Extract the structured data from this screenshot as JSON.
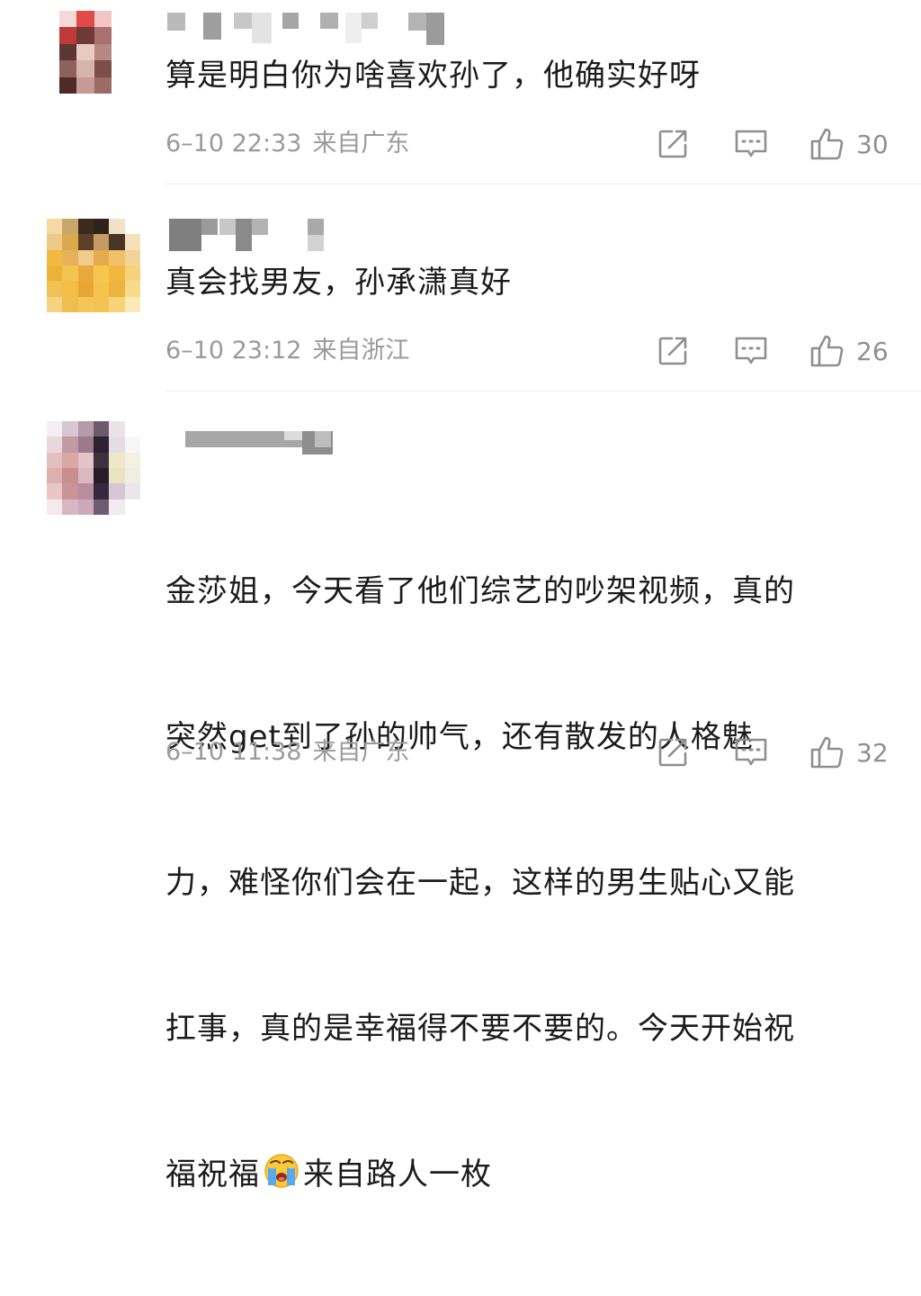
{
  "comments": [
    {
      "text": "算是明白你为啥喜欢孙了，他确实好呀",
      "time": "6–10 22:33",
      "location": "来自广东",
      "likes": "30"
    },
    {
      "text": "真会找男友，孙承潇真好",
      "time": "6–10 23:12",
      "location": "来自浙江",
      "likes": "26"
    },
    {
      "text_lines": [
        "金莎姐，今天看了他们综艺的吵架视频，真的",
        "突然get到了孙的帅气，还有散发的人格魅",
        "力，难怪你们会在一起，这样的男生贴心又能",
        "扛事，真的是幸福得不要不要的。今天开始祝"
      ],
      "text_last_before_emoji": "福祝福",
      "emoji": "crying-face-emoji",
      "text_last_after_emoji": "来自路人一枚",
      "time": "6–10 11:38",
      "location": "来自广东",
      "likes": "32"
    }
  ],
  "icons": {
    "share": "share-icon",
    "reply": "comment-icon",
    "like": "thumbs-up-icon"
  },
  "colors": {
    "text": "#1b1b1b",
    "meta": "#9a9a9a",
    "icon": "#8f8f8f",
    "divider": "#ececec"
  }
}
